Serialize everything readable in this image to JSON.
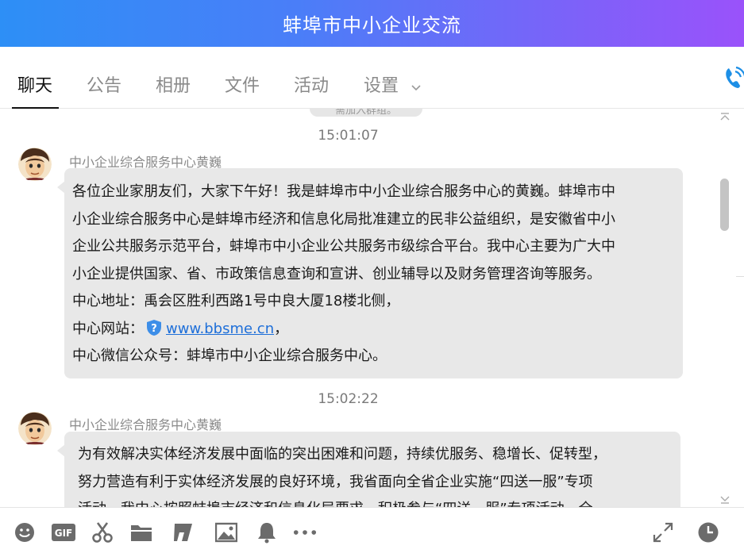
{
  "window": {
    "title": "蚌埠市中小企业交流"
  },
  "tabs": [
    {
      "label": "聊天",
      "active": true
    },
    {
      "label": "公告",
      "active": false
    },
    {
      "label": "相册",
      "active": false
    },
    {
      "label": "文件",
      "active": false
    },
    {
      "label": "活动",
      "active": false
    },
    {
      "label": "设置",
      "active": false
    }
  ],
  "chat": {
    "prev_message_stub": "需加入群组。",
    "messages": [
      {
        "time": "15:01:07",
        "sender": "中小企业综合服务中心黄巍",
        "lines": [
          "各位企业家朋友们，大家下午好！我是蚌埠市中小企业综合服务中心的黄巍。蚌埠市中",
          "小企业综合服务中心是蚌埠市经济和信息化局批准建立的民非公益组织，是安徽省中小",
          "企业公共服务示范平台，蚌埠市中小企业公共服务市级综合平台。我中心主要为广大中",
          "小企业提供国家、省、市政策信息查询和宣讲、创业辅导以及财务管理咨询等服务。",
          "中心地址：禹会区胜利西路1号中良大厦18楼北侧，"
        ],
        "website_label": "中心网站：",
        "website_link": "www.bbsme.cn",
        "website_suffix": "，",
        "wechat_line": "中心微信公众号：蚌埠市中小企业综合服务中心。"
      },
      {
        "time": "15:02:22",
        "sender": "中小企业综合服务中心黄巍",
        "lines": [
          "为有效解决实体经济发展中面临的突出困难和问题，持续优服务、稳增长、促转型，",
          "努力营造有利于实体经济发展的良好环境，我省面向全省企业实施“四送一服”专项",
          "活动。我中心按照蚌埠市经济和信息化局要求，积极参与“四送一服”专项活动，全"
        ]
      }
    ]
  },
  "toolbar": {
    "icons": [
      "emoji-icon",
      "gif-icon",
      "screenshot-scissors-icon",
      "folder-icon",
      "music-icon",
      "image-icon",
      "bell-icon",
      "more-icon",
      "expand-icon",
      "history-clock-icon"
    ]
  },
  "colors": {
    "title_gradient_start": "#2d8ff6",
    "title_gradient_end": "#9a52fa",
    "bubble": "#e8e8e8",
    "link": "#1e6fd9"
  }
}
